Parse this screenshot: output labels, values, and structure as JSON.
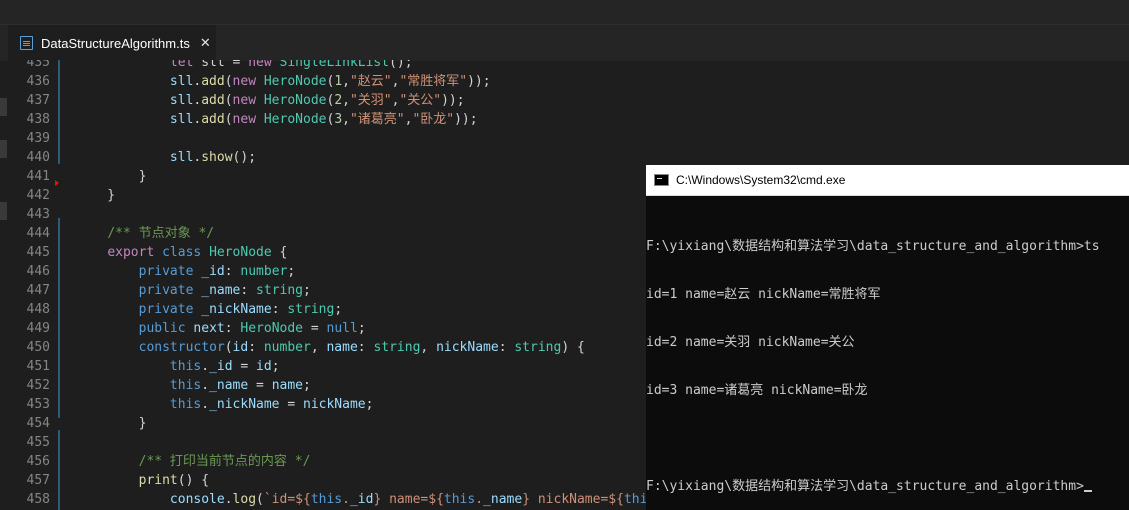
{
  "tab": {
    "title": "DataStructureAlgorithm.ts",
    "close": "✕",
    "icon": "typescript-file-icon"
  },
  "editor": {
    "lines": [
      {
        "n": "435",
        "tokens": [
          [
            "",
            "            "
          ],
          [
            "kw",
            "let"
          ],
          [
            "",
            " sll = "
          ],
          [
            "kw",
            "new"
          ],
          [
            "",
            " "
          ],
          [
            "ty",
            "SingleLinkList"
          ],
          [
            "",
            "();"
          ]
        ]
      },
      {
        "n": "436",
        "tokens": [
          [
            "",
            "            "
          ],
          [
            "pr",
            "sll"
          ],
          [
            "",
            "."
          ],
          [
            "fn",
            "add"
          ],
          [
            "",
            "("
          ],
          [
            "kw",
            "new"
          ],
          [
            "",
            " "
          ],
          [
            "ty",
            "HeroNode"
          ],
          [
            "",
            "("
          ],
          [
            "num",
            "1"
          ],
          [
            "",
            ","
          ],
          [
            "str",
            "\"赵云\""
          ],
          [
            "",
            ","
          ],
          [
            "str",
            "\"常胜将军\""
          ],
          [
            "",
            "));"
          ]
        ]
      },
      {
        "n": "437",
        "tokens": [
          [
            "",
            "            "
          ],
          [
            "pr",
            "sll"
          ],
          [
            "",
            "."
          ],
          [
            "fn",
            "add"
          ],
          [
            "",
            "("
          ],
          [
            "kw",
            "new"
          ],
          [
            "",
            " "
          ],
          [
            "ty",
            "HeroNode"
          ],
          [
            "",
            "("
          ],
          [
            "num",
            "2"
          ],
          [
            "",
            ","
          ],
          [
            "str",
            "\"关羽\""
          ],
          [
            "",
            ","
          ],
          [
            "str",
            "\"关公\""
          ],
          [
            "",
            "));"
          ]
        ]
      },
      {
        "n": "438",
        "tokens": [
          [
            "",
            "            "
          ],
          [
            "pr",
            "sll"
          ],
          [
            "",
            "."
          ],
          [
            "fn",
            "add"
          ],
          [
            "",
            "("
          ],
          [
            "kw",
            "new"
          ],
          [
            "",
            " "
          ],
          [
            "ty",
            "HeroNode"
          ],
          [
            "",
            "("
          ],
          [
            "num",
            "3"
          ],
          [
            "",
            ","
          ],
          [
            "str",
            "\"诸葛亮\""
          ],
          [
            "",
            ","
          ],
          [
            "str",
            "\"卧龙\""
          ],
          [
            "",
            "));"
          ]
        ]
      },
      {
        "n": "439",
        "tokens": []
      },
      {
        "n": "440",
        "tokens": [
          [
            "",
            "            "
          ],
          [
            "pr",
            "sll"
          ],
          [
            "",
            "."
          ],
          [
            "fn",
            "show"
          ],
          [
            "",
            "();"
          ]
        ]
      },
      {
        "n": "441",
        "tokens": [
          [
            "",
            "        }"
          ]
        ]
      },
      {
        "n": "442",
        "tokens": [
          [
            "",
            "    }"
          ]
        ]
      },
      {
        "n": "443",
        "tokens": []
      },
      {
        "n": "444",
        "tokens": [
          [
            "",
            "    "
          ],
          [
            "cm",
            "/** 节点对象 */"
          ]
        ]
      },
      {
        "n": "445",
        "tokens": [
          [
            "",
            "    "
          ],
          [
            "kw",
            "export"
          ],
          [
            "",
            " "
          ],
          [
            "bl",
            "class"
          ],
          [
            "",
            " "
          ],
          [
            "ty",
            "HeroNode"
          ],
          [
            "",
            " {"
          ]
        ]
      },
      {
        "n": "446",
        "tokens": [
          [
            "",
            "        "
          ],
          [
            "bl",
            "private"
          ],
          [
            "",
            " "
          ],
          [
            "pr",
            "_id"
          ],
          [
            "",
            ": "
          ],
          [
            "ty",
            "number"
          ],
          [
            "",
            ";"
          ]
        ]
      },
      {
        "n": "447",
        "tokens": [
          [
            "",
            "        "
          ],
          [
            "bl",
            "private"
          ],
          [
            "",
            " "
          ],
          [
            "pr",
            "_name"
          ],
          [
            "",
            ": "
          ],
          [
            "ty",
            "string"
          ],
          [
            "",
            ";"
          ]
        ]
      },
      {
        "n": "448",
        "tokens": [
          [
            "",
            "        "
          ],
          [
            "bl",
            "private"
          ],
          [
            "",
            " "
          ],
          [
            "pr",
            "_nickName"
          ],
          [
            "",
            ": "
          ],
          [
            "ty",
            "string"
          ],
          [
            "",
            ";"
          ]
        ]
      },
      {
        "n": "449",
        "tokens": [
          [
            "",
            "        "
          ],
          [
            "bl",
            "public"
          ],
          [
            "",
            " "
          ],
          [
            "pr",
            "next"
          ],
          [
            "",
            ": "
          ],
          [
            "ty",
            "HeroNode"
          ],
          [
            "",
            " = "
          ],
          [
            "bl",
            "null"
          ],
          [
            "",
            ";"
          ]
        ]
      },
      {
        "n": "450",
        "tokens": [
          [
            "",
            "        "
          ],
          [
            "bl",
            "constructor"
          ],
          [
            "",
            "("
          ],
          [
            "pr",
            "id"
          ],
          [
            "",
            ": "
          ],
          [
            "ty",
            "number"
          ],
          [
            "",
            ", "
          ],
          [
            "pr",
            "name"
          ],
          [
            "",
            ": "
          ],
          [
            "ty",
            "string"
          ],
          [
            "",
            ", "
          ],
          [
            "pr",
            "nickName"
          ],
          [
            "",
            ": "
          ],
          [
            "ty",
            "string"
          ],
          [
            "",
            ") {"
          ]
        ]
      },
      {
        "n": "451",
        "tokens": [
          [
            "",
            "            "
          ],
          [
            "bl",
            "this"
          ],
          [
            "",
            "."
          ],
          [
            "pr",
            "_id"
          ],
          [
            "",
            " = "
          ],
          [
            "pr",
            "id"
          ],
          [
            "",
            ";"
          ]
        ]
      },
      {
        "n": "452",
        "tokens": [
          [
            "",
            "            "
          ],
          [
            "bl",
            "this"
          ],
          [
            "",
            "."
          ],
          [
            "pr",
            "_name"
          ],
          [
            "",
            " = "
          ],
          [
            "pr",
            "name"
          ],
          [
            "",
            ";"
          ]
        ]
      },
      {
        "n": "453",
        "tokens": [
          [
            "",
            "            "
          ],
          [
            "bl",
            "this"
          ],
          [
            "",
            "."
          ],
          [
            "pr",
            "_nickName"
          ],
          [
            "",
            " = "
          ],
          [
            "pr",
            "nickName"
          ],
          [
            "",
            ";"
          ]
        ]
      },
      {
        "n": "454",
        "tokens": [
          [
            "",
            "        }"
          ]
        ]
      },
      {
        "n": "455",
        "tokens": []
      },
      {
        "n": "456",
        "tokens": [
          [
            "",
            "        "
          ],
          [
            "cm",
            "/** 打印当前节点的内容 */"
          ]
        ]
      },
      {
        "n": "457",
        "tokens": [
          [
            "",
            "        "
          ],
          [
            "fn",
            "print"
          ],
          [
            "",
            "() {"
          ]
        ]
      },
      {
        "n": "458",
        "tokens": [
          [
            "",
            "            "
          ],
          [
            "pr",
            "console"
          ],
          [
            "",
            "."
          ],
          [
            "fn",
            "log"
          ],
          [
            "",
            "("
          ],
          [
            "str",
            "`id=${"
          ],
          [
            "bl",
            "this"
          ],
          [
            "str",
            "."
          ],
          [
            "pr",
            "_id"
          ],
          [
            "str",
            "} name=${"
          ],
          [
            "bl",
            "this"
          ],
          [
            "str",
            "."
          ],
          [
            "pr",
            "_name"
          ],
          [
            "str",
            "} nickName=${"
          ],
          [
            "bl",
            "this"
          ]
        ]
      }
    ]
  },
  "cmd": {
    "title": "C:\\Windows\\System32\\cmd.exe",
    "icon": "console-icon",
    "lines": [
      "F:\\yixiang\\数据结构和算法学习\\data_structure_and_algorithm>ts",
      "id=1 name=赵云 nickName=常胜将军",
      "id=2 name=关羽 nickName=关公",
      "id=3 name=诸葛亮 nickName=卧龙",
      "",
      "F:\\yixiang\\数据结构和算法学习\\data_structure_and_algorithm>"
    ]
  },
  "colors": {
    "editor_bg": "#1e1e1e",
    "keyword": "#c586c0",
    "builtin": "#569cd6",
    "type": "#4ec9b0",
    "function": "#dcdcaa",
    "string": "#ce9178",
    "number": "#b5cea8",
    "comment": "#6a9955",
    "property": "#9cdcfe",
    "console_bg": "#0c0c0c"
  }
}
